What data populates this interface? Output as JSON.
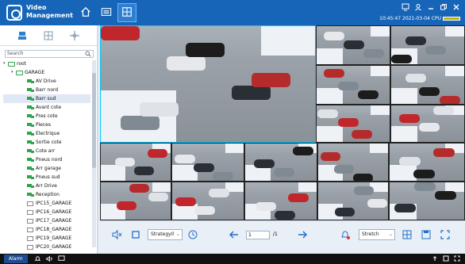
{
  "app": {
    "title_line1": "Video",
    "title_line2": "Management",
    "datetime": "10:45:47 2021-03-04",
    "cpu_label": "CPU"
  },
  "nav": {
    "items": [
      {
        "name": "home-icon"
      },
      {
        "name": "device-list-icon"
      },
      {
        "name": "live-view-icon",
        "active": true
      }
    ]
  },
  "sidebar": {
    "tabs": [
      "camera-tree-icon",
      "grid-icon",
      "ptz-icon"
    ],
    "search_placeholder": "Search",
    "tree": {
      "root": "root",
      "group": "GARAGE",
      "items": [
        {
          "label": "AV Drive",
          "status": "online"
        },
        {
          "label": "Barr nord",
          "status": "online"
        },
        {
          "label": "Barr sud",
          "status": "online",
          "selected": true
        },
        {
          "label": "Avant cote",
          "status": "online"
        },
        {
          "label": "Pres cote",
          "status": "online"
        },
        {
          "label": "Pieces",
          "status": "online"
        },
        {
          "label": "Electrique",
          "status": "online"
        },
        {
          "label": "Sortie cote",
          "status": "online"
        },
        {
          "label": "Cote arr",
          "status": "online"
        },
        {
          "label": "Pneus nord",
          "status": "online"
        },
        {
          "label": "Arr garage",
          "status": "online"
        },
        {
          "label": "Pneus sud",
          "status": "online"
        },
        {
          "label": "Arr Drive",
          "status": "online"
        },
        {
          "label": "Reception",
          "status": "online"
        },
        {
          "label": "IPC15_GARAGE",
          "status": "offline"
        },
        {
          "label": "IPC16_GARAGE",
          "status": "offline"
        },
        {
          "label": "IPC17_GARAGE",
          "status": "offline"
        },
        {
          "label": "IPC18_GARAGE",
          "status": "offline"
        },
        {
          "label": "IPC19_GARAGE",
          "status": "offline"
        },
        {
          "label": "IPC20_GARAGE",
          "status": "offline"
        }
      ]
    }
  },
  "controls": {
    "strategy": "Strategy0",
    "page_current": "1",
    "page_total": "/1",
    "stream": "Stretch"
  },
  "statusbar": {
    "alarm": "Alarm"
  }
}
